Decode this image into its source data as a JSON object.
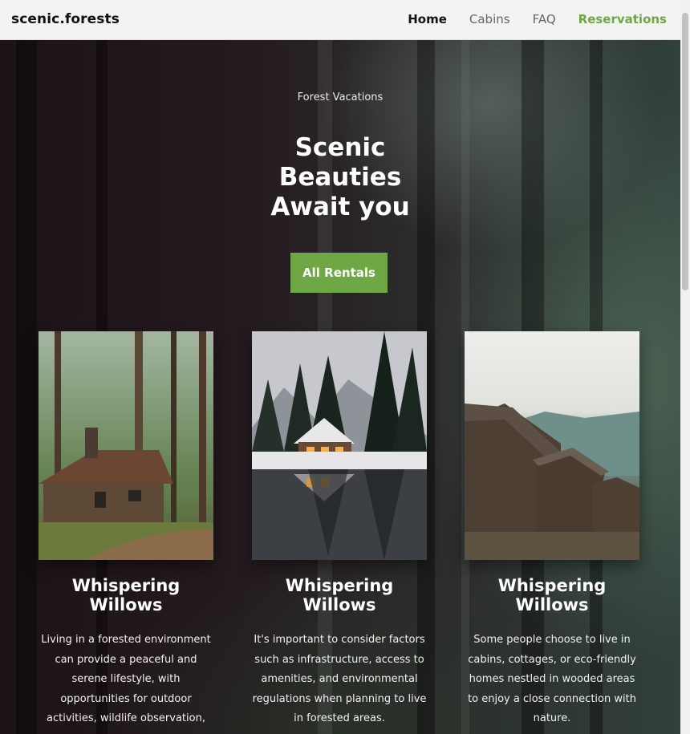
{
  "nav": {
    "brand": "scenic.forests",
    "links": [
      {
        "label": "Home",
        "state": "active"
      },
      {
        "label": "Cabins",
        "state": "normal"
      },
      {
        "label": "FAQ",
        "state": "normal"
      },
      {
        "label": "Reservations",
        "state": "accent"
      }
    ]
  },
  "hero": {
    "eyebrow": "Forest Vacations",
    "title_lines": [
      "Scenic",
      "Beauties",
      "Await you"
    ],
    "cta_label": "All Rentals"
  },
  "cards": [
    {
      "title_lines": [
        "Whispering",
        "Willows"
      ],
      "text_lines": [
        "Living in a forested environment",
        "can provide a peaceful and",
        "serene lifestyle, with",
        "opportunities for outdoor",
        "activities, wildlife observation,"
      ],
      "image": "log-cabin-forest-image"
    },
    {
      "title_lines": [
        "Whispering",
        "Willows"
      ],
      "text_lines": [
        "It's important to consider factors",
        "such as infrastructure, access to",
        "amenities, and environmental",
        "regulations when planning to live",
        "in forested areas."
      ],
      "image": "lakeside-lodge-snow-image"
    },
    {
      "title_lines": [
        "Whispering",
        "Willows"
      ],
      "text_lines": [
        "Some people choose to live in",
        "cabins, cottages, or eco-friendly",
        "homes nestled in wooded areas",
        "to enjoy a close connection with",
        "nature."
      ],
      "image": "mountain-huts-image"
    }
  ],
  "colors": {
    "accent": "#6ea744",
    "nav_bg": "#f3f3f3"
  }
}
